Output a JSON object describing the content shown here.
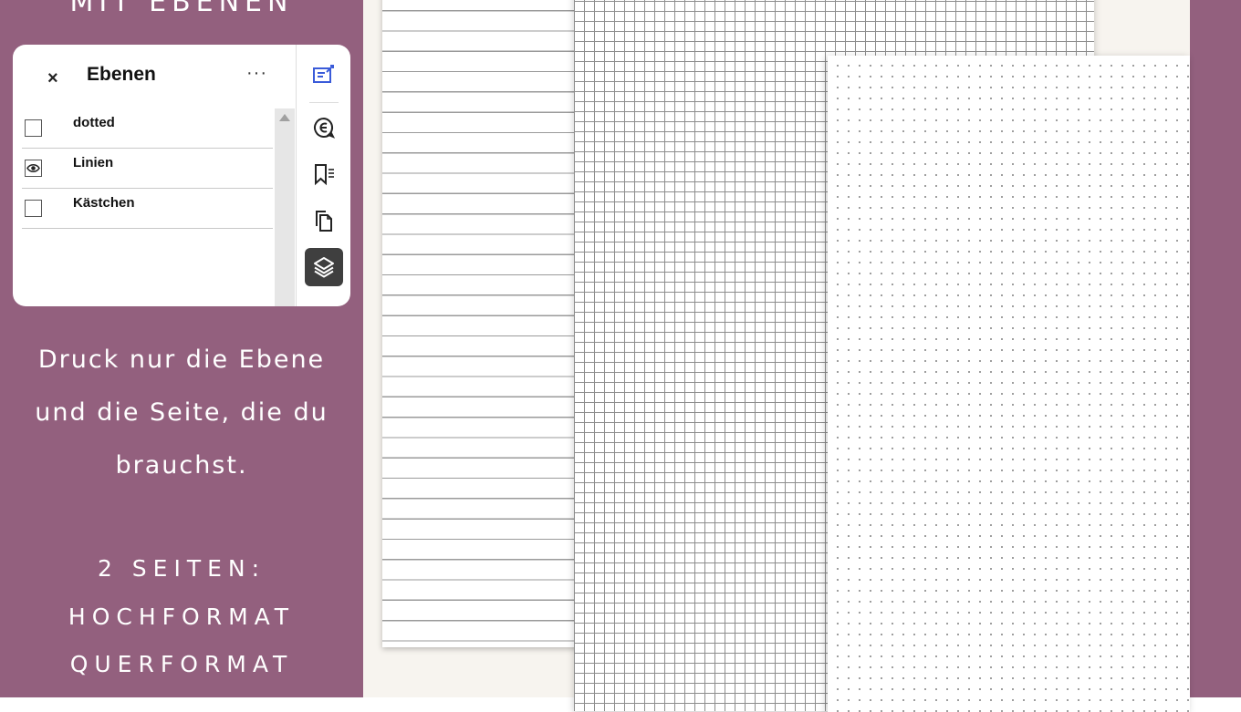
{
  "heading_top": "MIT EBENEN",
  "panel": {
    "close_label": "×",
    "title": "Ebenen",
    "more_label": "···",
    "layers": [
      {
        "label": "dotted",
        "visible": false
      },
      {
        "label": "Linien",
        "visible": true
      },
      {
        "label": "Kästchen",
        "visible": false
      }
    ],
    "toolbar_icons": [
      "document-edit-icon",
      "comment-icon",
      "bookmark-list-icon",
      "copy-pages-icon",
      "layers-icon"
    ],
    "active_tool": "layers-icon",
    "accent_color": "#3a5bd9"
  },
  "description": {
    "line1": "Druck nur die Ebene",
    "line2": "und die Seite, die du",
    "line3": "brauchst."
  },
  "pages_info": {
    "line1": "2 SEITEN:",
    "line2": "HOCHFORMAT",
    "line3": "QUERFORMAT"
  },
  "colors": {
    "background": "#93607e",
    "paper": "#ffffff",
    "canvas": "#f7f4ef"
  }
}
